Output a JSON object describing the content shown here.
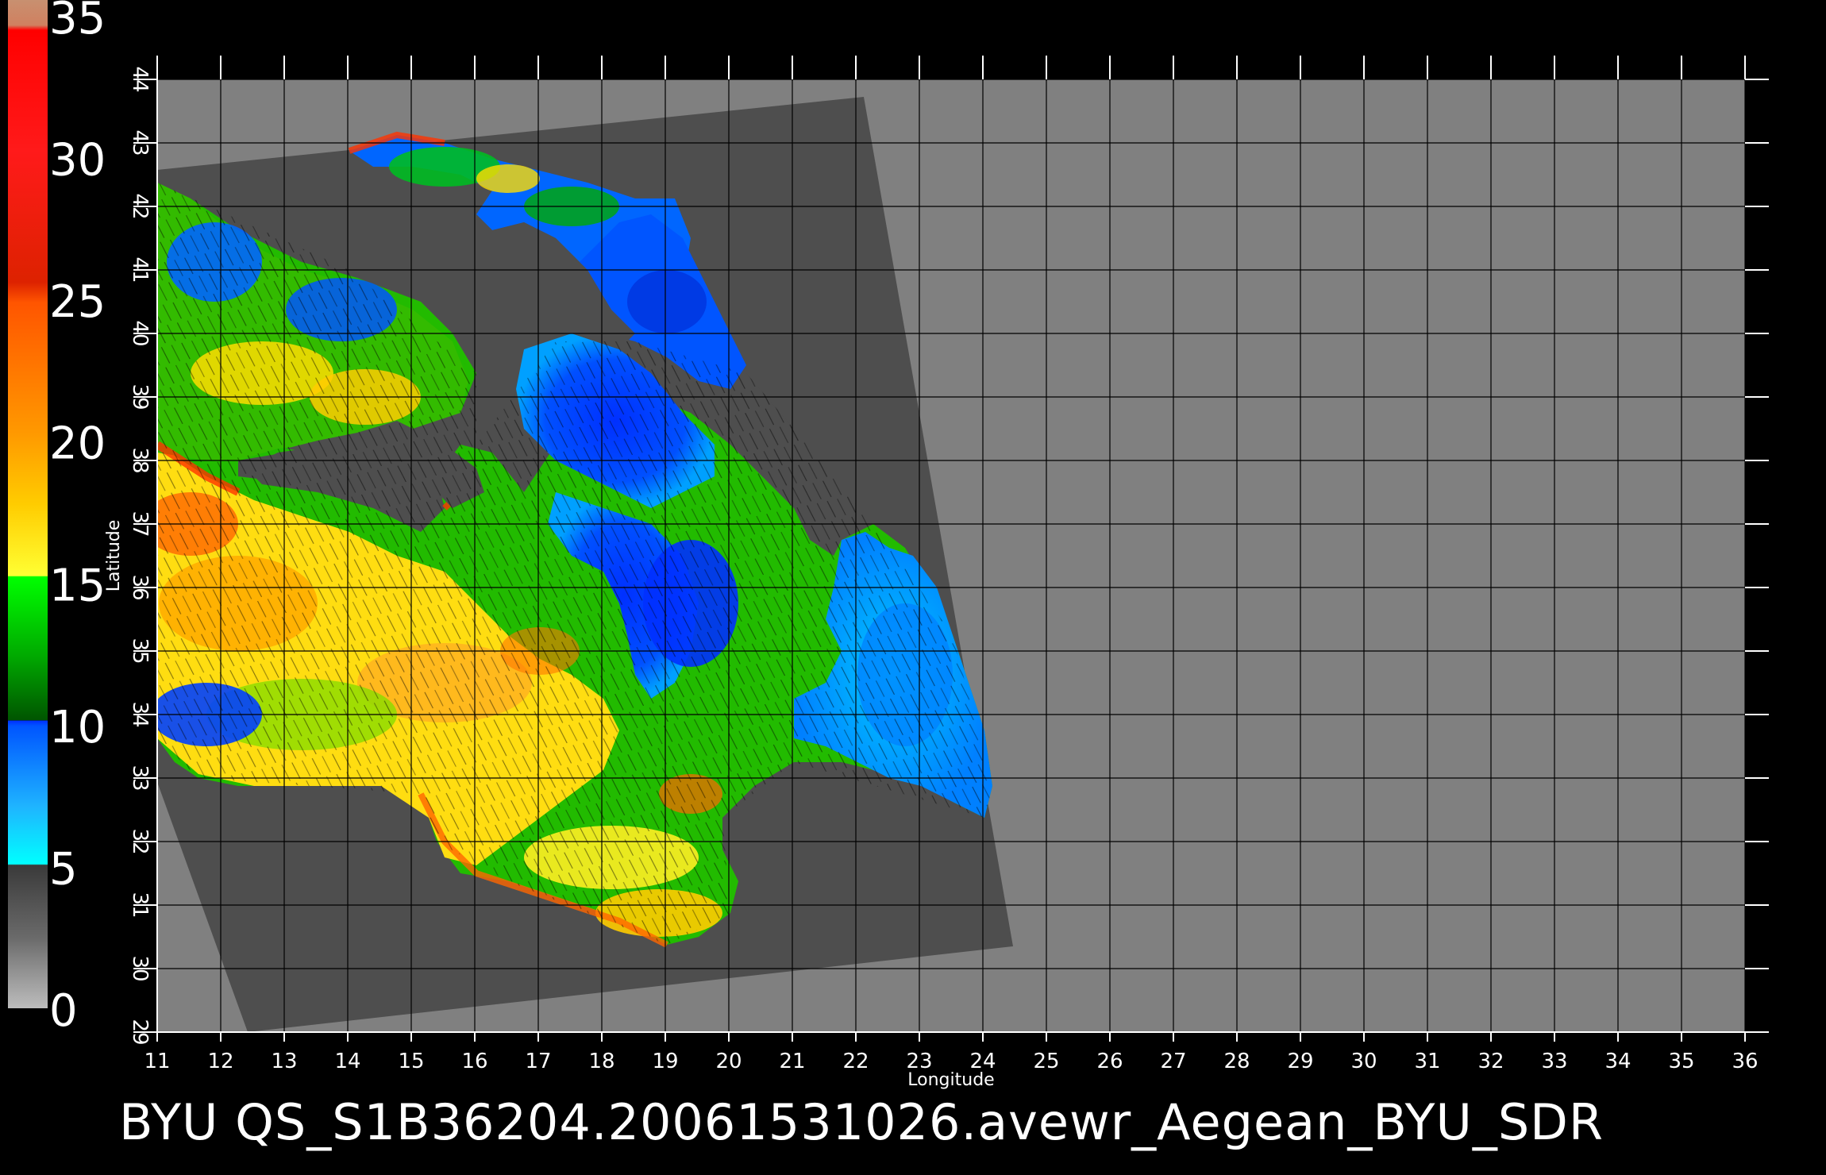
{
  "title": "BYU  QS_S1B36204.20061531026.avewr_Aegean_BYU_SDR",
  "colorbar": {
    "labels": [
      "35",
      "30",
      "25",
      "20",
      "15",
      "10",
      "5",
      "0"
    ],
    "range": [
      0,
      35
    ],
    "colors": [
      "#bfbfbf",
      "#7a7a7a",
      "#4a4a4a",
      "#00ffff",
      "#22aaff",
      "#0060ff",
      "#0020e0",
      "#009900",
      "#00cc00",
      "#ffff00",
      "#ffcc00",
      "#ff7700",
      "#ff3300",
      "#ff0000",
      "#cc8866"
    ]
  },
  "axes": {
    "xlabel": "Longitude",
    "ylabel": "Latitude",
    "lon_ticks": [
      "11",
      "12",
      "13",
      "14",
      "15",
      "16",
      "17",
      "18",
      "19",
      "20",
      "21",
      "22",
      "23",
      "24",
      "25",
      "26",
      "27",
      "28",
      "29",
      "30",
      "31",
      "32",
      "33",
      "34",
      "35",
      "36"
    ],
    "lat_ticks": [
      "29",
      "30",
      "31",
      "32",
      "33",
      "34",
      "35",
      "36",
      "37",
      "38",
      "39",
      "40",
      "41",
      "42",
      "43",
      "44"
    ],
    "lon_range": [
      11,
      36
    ],
    "lat_range": [
      29,
      44
    ]
  },
  "map": {
    "background_color": "#808080",
    "swath_color": "#4e4e4e",
    "grid_color": "#000000"
  }
}
